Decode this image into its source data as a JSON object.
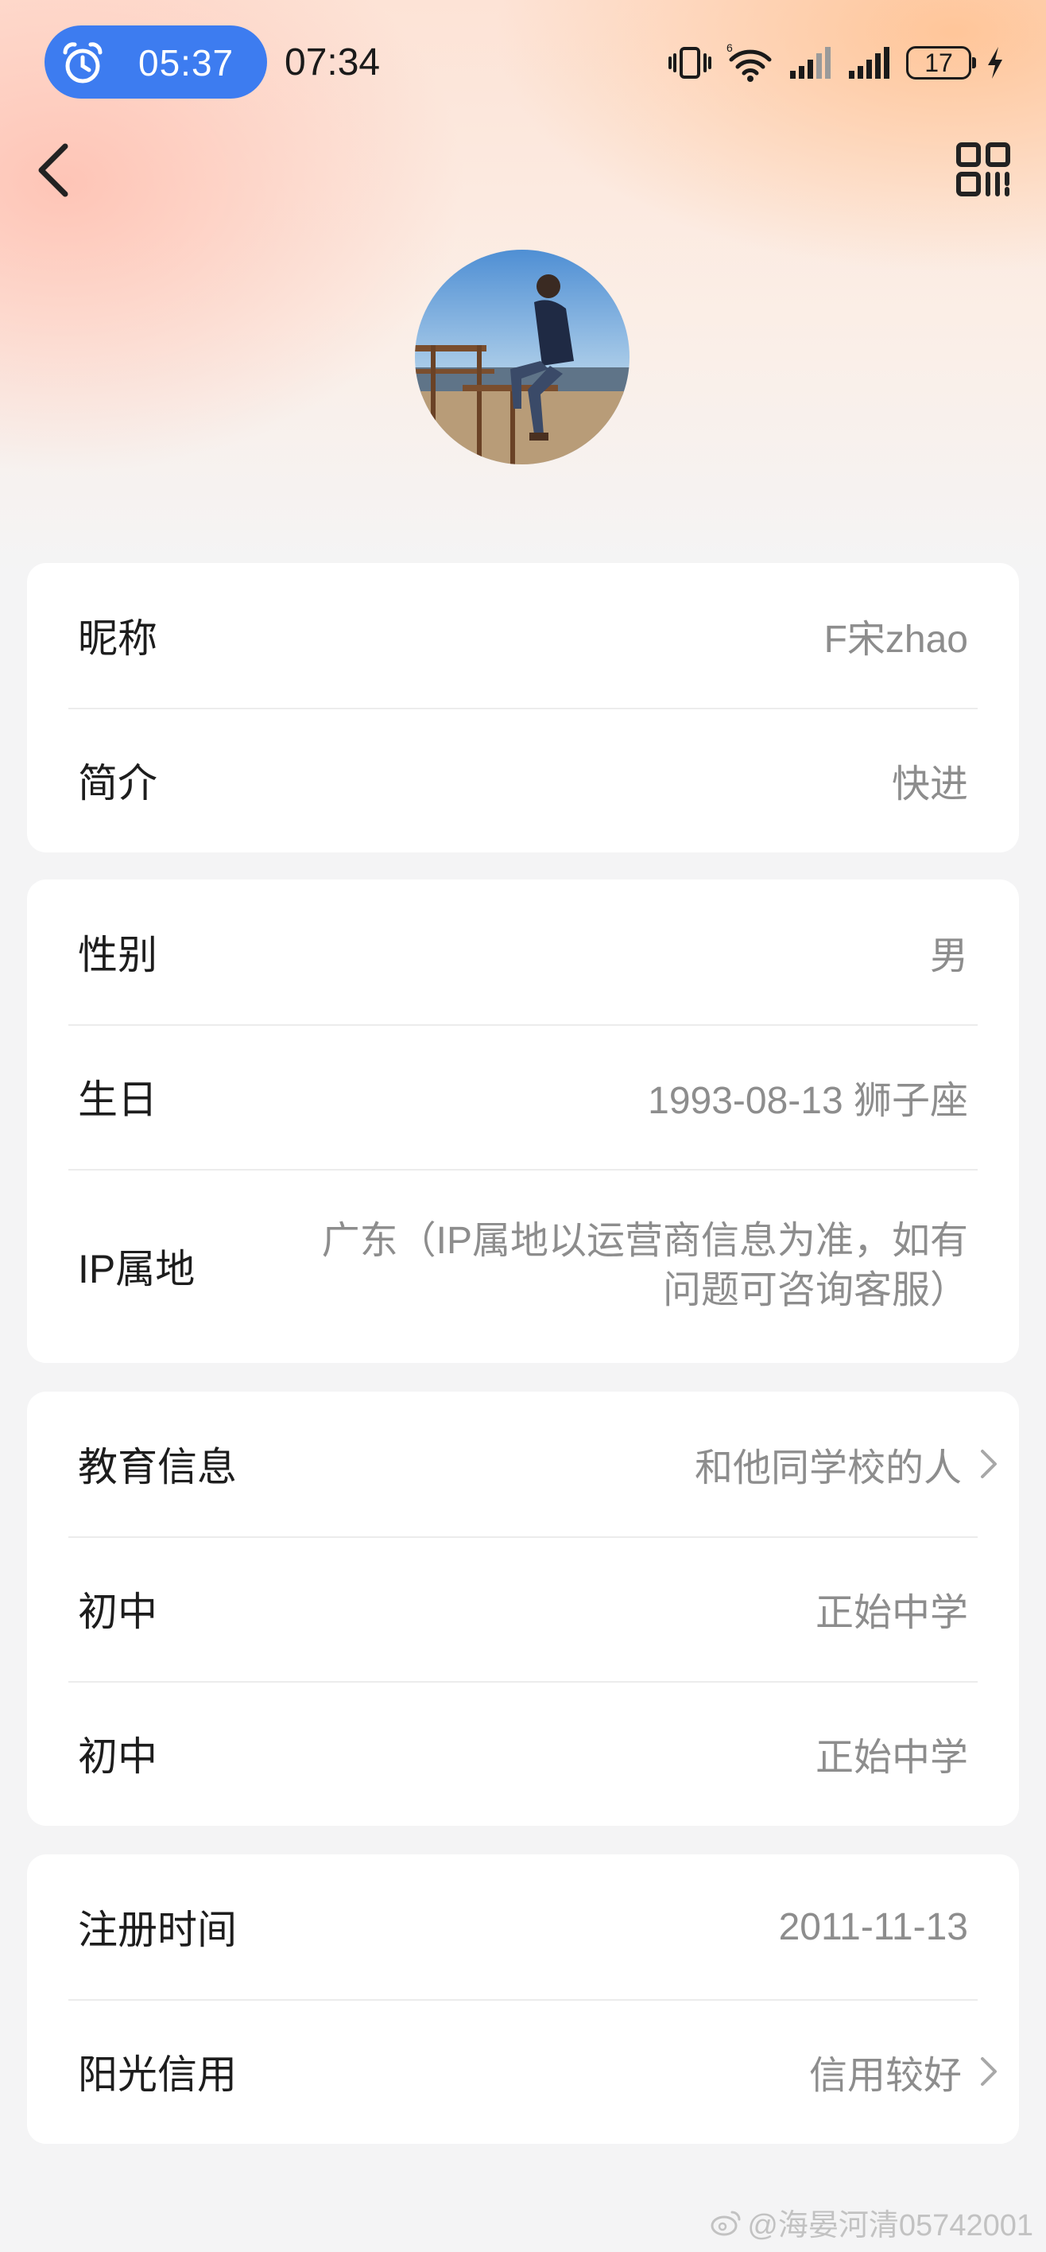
{
  "status_bar": {
    "alarm_time": "05:37",
    "clock": "07:34",
    "battery": "17",
    "network_label": "6"
  },
  "header": {
    "back_icon": "back-chevron-icon",
    "qr_icon": "qr-code-icon"
  },
  "card1": {
    "nickname_label": "昵称",
    "nickname_value": "F宋zhao",
    "bio_label": "简介",
    "bio_value": "快进"
  },
  "card2": {
    "gender_label": "性别",
    "gender_value": "男",
    "birthday_label": "生日",
    "birthday_value": "1993-08-13 狮子座",
    "ip_label": "IP属地",
    "ip_value": "广东（IP属地以运营商信息为准，如有问题可咨询客服）"
  },
  "card3": {
    "education_label": "教育信息",
    "education_value": "和他同学校的人",
    "school1_label": "初中",
    "school1_value": "正始中学",
    "school2_label": "初中",
    "school2_value": "正始中学"
  },
  "card4": {
    "register_label": "注册时间",
    "register_value": "2011-11-13",
    "credit_label": "阳光信用",
    "credit_value": "信用较好"
  },
  "watermark": "@海晏河清05742001"
}
